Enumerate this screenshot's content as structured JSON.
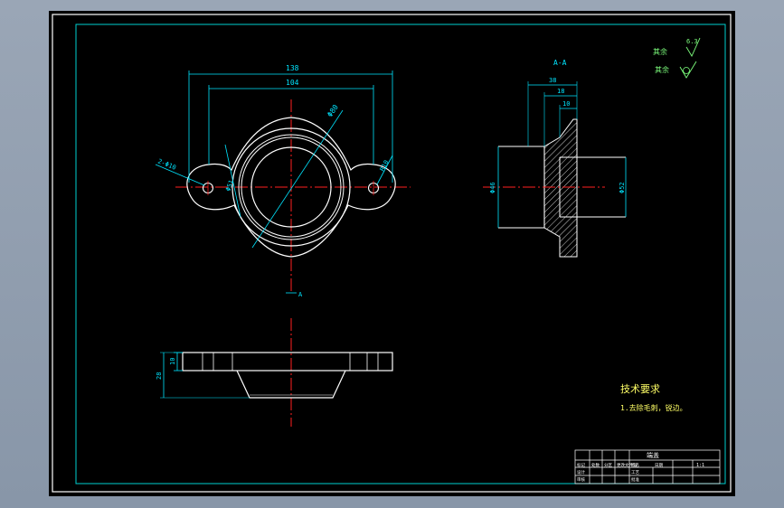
{
  "drawing": {
    "title_block": {
      "part_name": "端盖",
      "scale_value": "1:1",
      "row_labels": [
        "设计",
        "审核",
        "工艺",
        "批准"
      ],
      "cell_labels": [
        "标记",
        "处数",
        "分区",
        "更改文件号",
        "签名",
        "日期"
      ]
    },
    "technical_requirements": {
      "heading": "技术要求",
      "items": [
        "1.去除毛刺，锐边。"
      ]
    },
    "roughness_notes": {
      "other": "其余",
      "other_value": "6.3",
      "remaining_label": "其余"
    },
    "section_label": "A-A",
    "section_marker": "A",
    "dimensions": {
      "top_overall": "138",
      "top_inner": "104",
      "diag_large": "Φ80",
      "hole_left": "2-Φ10",
      "hole_right": "R10",
      "inner_diam": "Φ51",
      "sec_width": "38",
      "sec_step1": "18",
      "sec_step2": "10",
      "sec_left_height": "Φ46",
      "sec_right_height": "Φ52",
      "front_thick": "10",
      "front_height": "28"
    }
  },
  "colors": {
    "frame": "#ffffff",
    "geometry": "#ffffff",
    "dimension": "#00e5ff",
    "centerline": "#ff2020",
    "hatch": "#ffffff",
    "text_yellow": "#ffff66",
    "text_green": "#7dff7d",
    "border_cyan": "#00d0d0"
  }
}
